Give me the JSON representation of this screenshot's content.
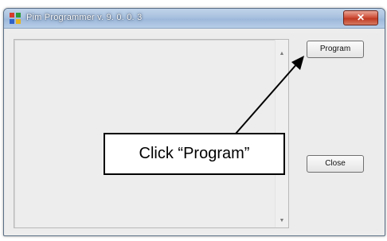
{
  "window": {
    "title": "Pim Programmer v. 9. 0. 0. 3",
    "close_glyph": "✕"
  },
  "output": {
    "scroll_up_glyph": "▲",
    "scroll_down_glyph": "▼"
  },
  "buttons": {
    "program_label": "Program",
    "close_label": "Close"
  },
  "annotation": {
    "callout_text": "Click “Program”"
  },
  "colors": {
    "titlebar": "#a9c1df",
    "close_button": "#c8452f",
    "window_bg": "#ededed"
  },
  "icons": {
    "app": "app-logo-icon",
    "close": "close-icon"
  }
}
